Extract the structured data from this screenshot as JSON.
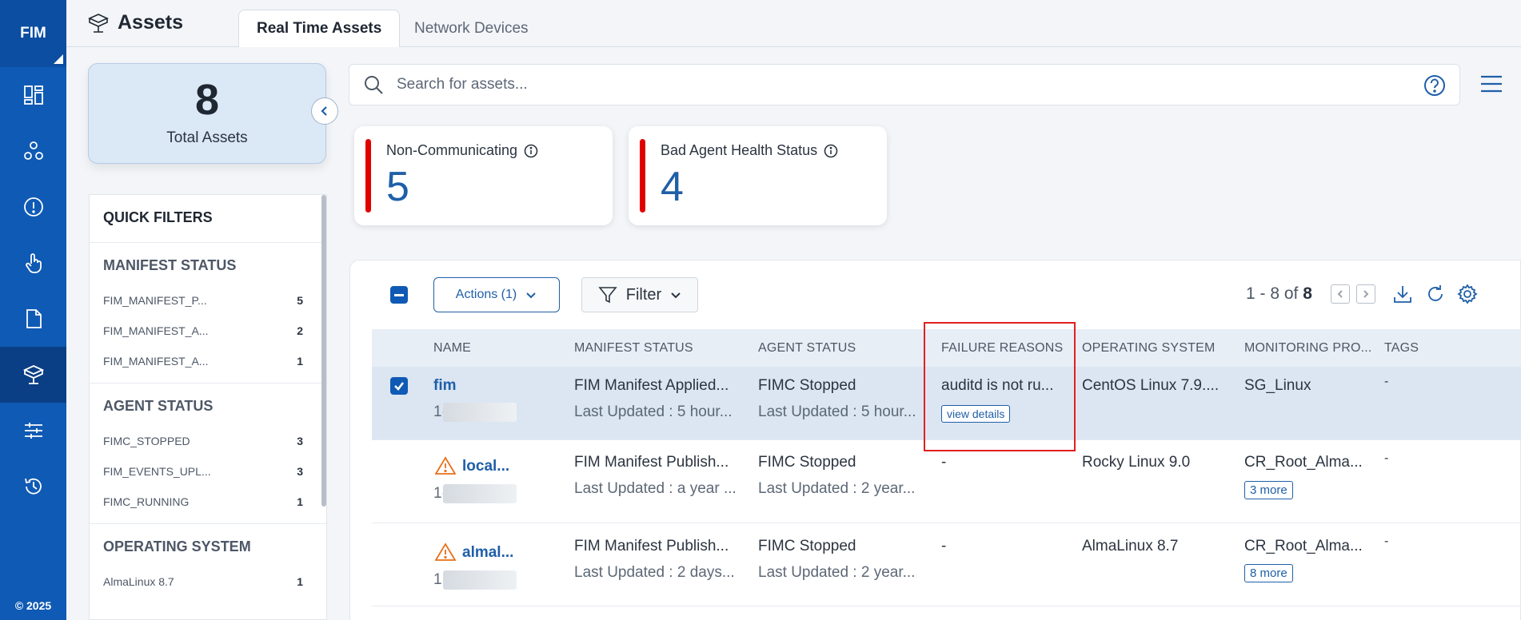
{
  "rail": {
    "logo": "FIM",
    "copyright": "© 2025",
    "items": [
      "dashboard-icon",
      "apps-icon",
      "alert-icon",
      "touch-icon",
      "document-icon",
      "assets-icon",
      "sliders-icon",
      "history-icon"
    ]
  },
  "header": {
    "title": "Assets",
    "tabs": [
      {
        "label": "Real Time Assets",
        "active": true
      },
      {
        "label": "Network Devices",
        "active": false
      }
    ]
  },
  "summary": {
    "total_value": "8",
    "total_label": "Total Assets"
  },
  "quick_filters": {
    "title": "QUICK FILTERS",
    "sections": [
      {
        "heading": "MANIFEST STATUS",
        "items": [
          {
            "label": "FIM_MANIFEST_P...",
            "count": "5"
          },
          {
            "label": "FIM_MANIFEST_A...",
            "count": "2"
          },
          {
            "label": "FIM_MANIFEST_A...",
            "count": "1"
          }
        ]
      },
      {
        "heading": "AGENT STATUS",
        "items": [
          {
            "label": "FIMC_STOPPED",
            "count": "3"
          },
          {
            "label": "FIM_EVENTS_UPL...",
            "count": "3"
          },
          {
            "label": "FIMC_RUNNING",
            "count": "1"
          }
        ]
      },
      {
        "heading": "OPERATING SYSTEM",
        "items": [
          {
            "label": "AlmaLinux 8.7",
            "count": "1"
          }
        ]
      }
    ]
  },
  "search": {
    "placeholder": "Search for assets..."
  },
  "metrics": [
    {
      "label": "Non-Communicating",
      "value": "5",
      "accent": "#e00000"
    },
    {
      "label": "Bad Agent Health Status",
      "value": "4",
      "accent": "#e00000"
    }
  ],
  "toolbar": {
    "actions_label": "Actions (1)",
    "filter_label": "Filter",
    "pager_range": "1 - 8 of",
    "pager_total": "8"
  },
  "table": {
    "columns": [
      "NAME",
      "MANIFEST STATUS",
      "AGENT STATUS",
      "FAILURE REASONS",
      "OPERATING SYSTEM",
      "MONITORING PRO...",
      "TAGS"
    ],
    "rows": [
      {
        "selected": true,
        "warning": false,
        "name": "fim",
        "id_prefix": "1(",
        "manifest": "FIM Manifest Applied...",
        "manifest_sub": "Last Updated : 5 hour...",
        "agent": "FIMC Stopped",
        "agent_sub": "Last Updated : 5 hour...",
        "failure": "auditd is not ru...",
        "failure_link": "view details",
        "os": "CentOS Linux 7.9....",
        "profile": "SG_Linux",
        "profile_more": "",
        "tags": "-"
      },
      {
        "selected": false,
        "warning": true,
        "name": "local...",
        "id_prefix": "1(",
        "manifest": "FIM Manifest Publish...",
        "manifest_sub": "Last Updated : a year ...",
        "agent": "FIMC Stopped",
        "agent_sub": "Last Updated : 2 year...",
        "failure": "-",
        "failure_link": "",
        "os": "Rocky Linux 9.0",
        "profile": "CR_Root_Alma...",
        "profile_more": "3 more",
        "tags": "-"
      },
      {
        "selected": false,
        "warning": true,
        "name": "almal...",
        "id_prefix": "1",
        "manifest": "FIM Manifest Publish...",
        "manifest_sub": "Last Updated : 2 days...",
        "agent": "FIMC Stopped",
        "agent_sub": "Last Updated : 2 year...",
        "failure": "-",
        "failure_link": "",
        "os": "AlmaLinux 8.7",
        "profile": "CR_Root_Alma...",
        "profile_more": "8 more",
        "tags": "-"
      }
    ]
  },
  "colors": {
    "rail": "#0f5ab4",
    "accent": "#1f5fa8",
    "alert": "#e00000",
    "warning": "#e8701a"
  }
}
